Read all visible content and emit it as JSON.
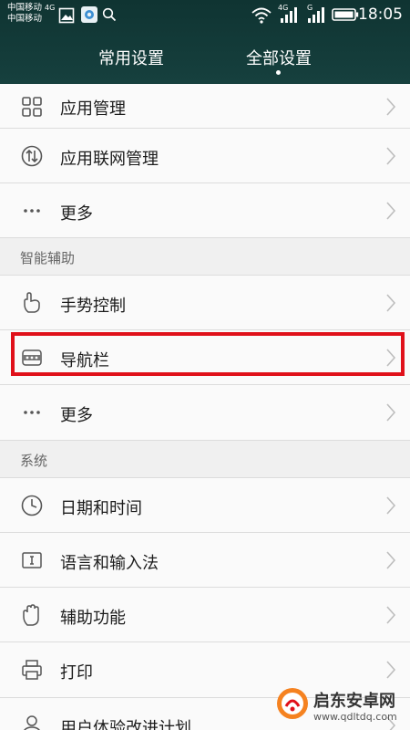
{
  "status_bar": {
    "carrier_1": "中国移动",
    "carrier_1_net": "4G",
    "carrier_2": "中国移动",
    "signal_1_label": "4G",
    "signal_2_label": "G",
    "time": "18:05"
  },
  "tabs": [
    {
      "label": "常用设置",
      "selected": false
    },
    {
      "label": "全部设置",
      "selected": true
    }
  ],
  "rows": [
    {
      "label": "应用管理",
      "icon": "grid-apps-icon"
    },
    {
      "label": "应用联网管理",
      "icon": "network-arrows-icon"
    },
    {
      "label": "更多",
      "icon": "more-dots-icon"
    },
    {
      "label": "手势控制",
      "icon": "gesture-hand-icon"
    },
    {
      "label": "导航栏",
      "icon": "navigation-bar-icon"
    },
    {
      "label": "更多",
      "icon": "more-dots-icon"
    },
    {
      "label": "日期和时间",
      "icon": "clock-icon"
    },
    {
      "label": "语言和输入法",
      "icon": "keyboard-cursor-icon"
    },
    {
      "label": "辅助功能",
      "icon": "hand-icon"
    },
    {
      "label": "打印",
      "icon": "printer-icon"
    },
    {
      "label": "用户体验改进计划",
      "icon": "user-icon"
    }
  ],
  "sections": [
    {
      "label": "智能辅助"
    },
    {
      "label": "系统"
    }
  ],
  "highlight_color": "#e0101a",
  "watermark": {
    "title": "启东安卓网",
    "url": "www.qdltdq.com"
  }
}
